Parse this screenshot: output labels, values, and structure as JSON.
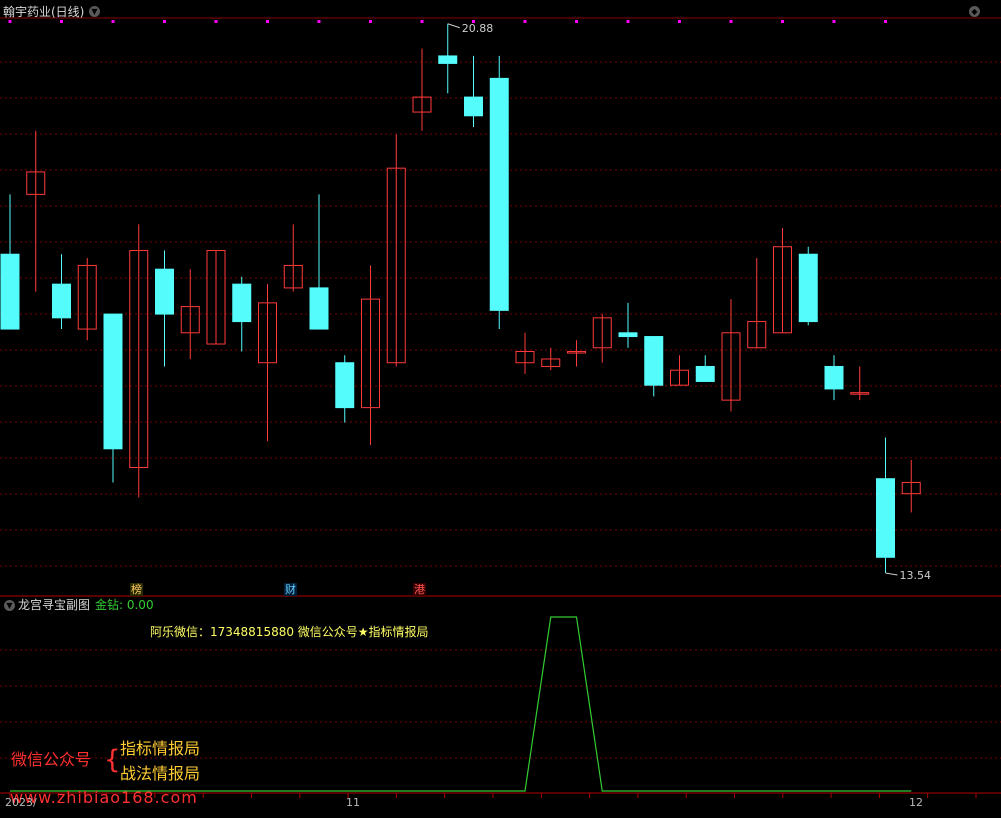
{
  "main_panel": {
    "title": "翰宇药业(日线)",
    "high_label": "20.88",
    "low_label": "13.54",
    "markers": [
      {
        "text": "榜",
        "color": "#ffcc66"
      },
      {
        "text": "财",
        "color": "#66ccff"
      },
      {
        "text": "港",
        "color": "#ff5555"
      }
    ],
    "candles": [
      {
        "o": 17.8,
        "h": 18.6,
        "l": 16.8,
        "c": 16.8
      },
      {
        "o": 18.6,
        "h": 19.45,
        "l": 17.3,
        "c": 18.9
      },
      {
        "o": 17.4,
        "h": 17.8,
        "l": 16.8,
        "c": 16.95
      },
      {
        "o": 16.8,
        "h": 17.75,
        "l": 16.65,
        "c": 17.65
      },
      {
        "o": 17.0,
        "h": 17.0,
        "l": 14.75,
        "c": 15.2
      },
      {
        "o": 14.95,
        "h": 18.2,
        "l": 14.55,
        "c": 17.85
      },
      {
        "o": 17.6,
        "h": 17.85,
        "l": 16.3,
        "c": 17.0
      },
      {
        "o": 16.75,
        "h": 17.6,
        "l": 16.4,
        "c": 17.1
      },
      {
        "o": 16.6,
        "h": 17.85,
        "l": 16.6,
        "c": 17.85
      },
      {
        "o": 17.4,
        "h": 17.5,
        "l": 16.5,
        "c": 16.9
      },
      {
        "o": 16.35,
        "h": 17.4,
        "l": 15.3,
        "c": 17.15
      },
      {
        "o": 17.35,
        "h": 18.2,
        "l": 17.3,
        "c": 17.65
      },
      {
        "o": 17.35,
        "h": 18.6,
        "l": 16.8,
        "c": 16.8
      },
      {
        "o": 16.35,
        "h": 16.45,
        "l": 15.55,
        "c": 15.75
      },
      {
        "o": 15.75,
        "h": 17.65,
        "l": 15.25,
        "c": 17.2
      },
      {
        "o": 16.35,
        "h": 19.4,
        "l": 16.3,
        "c": 18.95
      },
      {
        "o": 19.7,
        "h": 20.55,
        "l": 19.45,
        "c": 19.9
      },
      {
        "o": 20.45,
        "h": 20.88,
        "l": 19.95,
        "c": 20.35
      },
      {
        "o": 19.9,
        "h": 20.45,
        "l": 19.5,
        "c": 19.65
      },
      {
        "o": 20.15,
        "h": 20.45,
        "l": 16.8,
        "c": 17.05
      },
      {
        "o": 16.35,
        "h": 16.75,
        "l": 16.2,
        "c": 16.5
      },
      {
        "o": 16.3,
        "h": 16.55,
        "l": 16.25,
        "c": 16.4
      },
      {
        "o": 16.5,
        "h": 16.65,
        "l": 16.3,
        "c": 16.5
      },
      {
        "o": 16.55,
        "h": 17.0,
        "l": 16.35,
        "c": 16.95
      },
      {
        "o": 16.75,
        "h": 17.15,
        "l": 16.55,
        "c": 16.7
      },
      {
        "o": 16.7,
        "h": 16.7,
        "l": 15.9,
        "c": 16.05
      },
      {
        "o": 16.05,
        "h": 16.45,
        "l": 16.05,
        "c": 16.25
      },
      {
        "o": 16.3,
        "h": 16.45,
        "l": 16.15,
        "c": 16.1
      },
      {
        "o": 15.85,
        "h": 17.2,
        "l": 15.7,
        "c": 16.75
      },
      {
        "o": 16.55,
        "h": 17.75,
        "l": 16.55,
        "c": 16.9
      },
      {
        "o": 16.75,
        "h": 18.15,
        "l": 16.75,
        "c": 17.9
      },
      {
        "o": 17.8,
        "h": 17.9,
        "l": 16.85,
        "c": 16.9
      },
      {
        "o": 16.3,
        "h": 16.45,
        "l": 15.85,
        "c": 16.0
      },
      {
        "o": 15.95,
        "h": 16.3,
        "l": 15.85,
        "c": 15.95
      },
      {
        "o": 14.8,
        "h": 15.35,
        "l": 13.54,
        "c": 13.75
      },
      {
        "o": 14.6,
        "h": 15.05,
        "l": 14.35,
        "c": 14.75
      }
    ]
  },
  "sub_panel": {
    "title": "龙宫寻宝副图",
    "indicator_label": "金钻: 0.00",
    "note": "阿乐微信：17348815880  微信公众号★指标情报局",
    "line_values": [
      0,
      0,
      0,
      0,
      0,
      0,
      0,
      0,
      0,
      0,
      0,
      0,
      0,
      0,
      0,
      0,
      0,
      0,
      0,
      0,
      0,
      1,
      1,
      0,
      0,
      0,
      0,
      0,
      0,
      0,
      0,
      0,
      0,
      0,
      0,
      0
    ]
  },
  "axis": {
    "labels": [
      "2023/",
      "11",
      "12"
    ]
  },
  "overlay": {
    "left_text": "微信公众号",
    "brace": "{",
    "line1": "指标情报局",
    "line2": "战法情报局",
    "watermark": "www.zhibiao168.com"
  },
  "colors": {
    "up": "#ff3a3a",
    "down": "#54fcfc",
    "grid": "#7a0000",
    "dots": "#ff00ff",
    "line": "#33cc33",
    "title": "#cccccc"
  }
}
